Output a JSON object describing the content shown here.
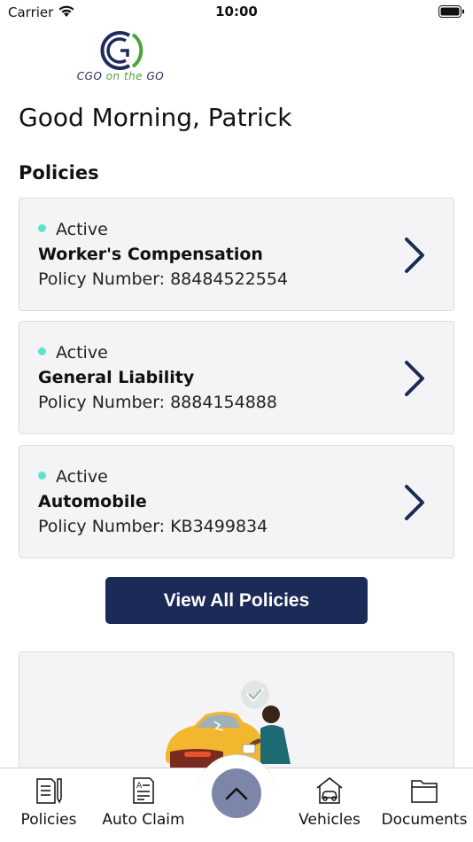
{
  "status_bar": {
    "carrier": "Carrier",
    "time": "10:00"
  },
  "logo": {
    "text_prefix": "CGO ",
    "text_mid": "on the",
    "text_suffix": " GO"
  },
  "greeting": "Good Morning, Patrick",
  "policies_section": {
    "title": "Policies",
    "number_label": "Policy Number:",
    "items": [
      {
        "status": "Active",
        "name": "Worker's Compensation",
        "number": "88484522554"
      },
      {
        "status": "Active",
        "name": "General Liability",
        "number": "8884154888"
      },
      {
        "status": "Active",
        "name": "Automobile",
        "number": "KB3499834"
      }
    ],
    "view_all_label": "View All Policies"
  },
  "tab_bar": {
    "tabs": [
      {
        "label": "Policies",
        "icon": "policies-document-icon"
      },
      {
        "label": "Auto Claim",
        "icon": "auto-claim-form-icon"
      },
      {
        "label": "Vehicles",
        "icon": "vehicles-garage-icon"
      },
      {
        "label": "Documents",
        "icon": "folder-icon"
      }
    ],
    "center_button_icon": "chevron-up-icon"
  },
  "colors": {
    "brand_navy": "#1b2a57",
    "status_active": "#5fe3cf",
    "fab": "#7c86a8",
    "logo_green": "#4ea33a"
  }
}
